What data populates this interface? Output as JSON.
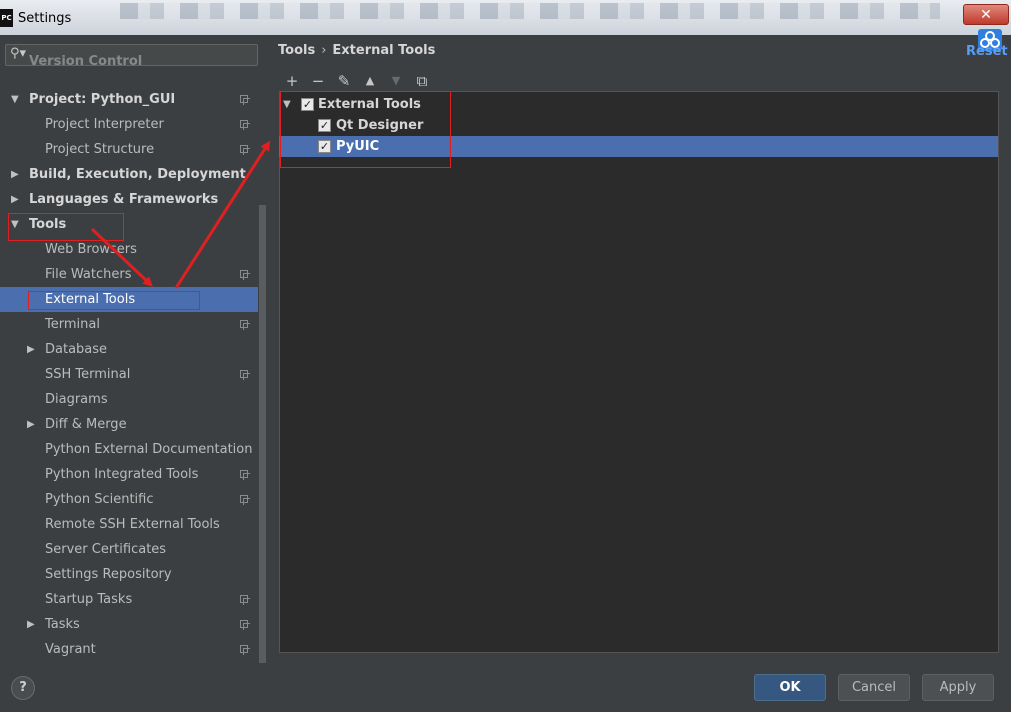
{
  "window": {
    "title": "Settings",
    "app_badge": "PC",
    "close": "✕"
  },
  "search": {
    "placeholder": "",
    "icon": "search-icon"
  },
  "tree": [
    {
      "label": "Version Control",
      "bold": true,
      "faded": true
    },
    {
      "label": "Project: Python_GUI",
      "bold": true,
      "expanded": true,
      "has_copy": true
    },
    {
      "label": "Project Interpreter",
      "has_copy": true
    },
    {
      "label": "Project Structure",
      "has_copy": true
    },
    {
      "label": "Build, Execution, Deployment",
      "bold": true,
      "collapsed": true
    },
    {
      "label": "Languages & Frameworks",
      "bold": true,
      "collapsed": true
    },
    {
      "label": "Tools",
      "bold": true,
      "expanded": true
    },
    {
      "label": "Web Browsers"
    },
    {
      "label": "File Watchers",
      "has_copy": true
    },
    {
      "label": "External Tools",
      "selected": true
    },
    {
      "label": "Terminal",
      "has_copy": true
    },
    {
      "label": "Database",
      "collapsed": true
    },
    {
      "label": "SSH Terminal",
      "has_copy": true
    },
    {
      "label": "Diagrams"
    },
    {
      "label": "Diff & Merge",
      "collapsed": true
    },
    {
      "label": "Python External Documentation"
    },
    {
      "label": "Python Integrated Tools",
      "has_copy": true
    },
    {
      "label": "Python Scientific",
      "has_copy": true
    },
    {
      "label": "Remote SSH External Tools"
    },
    {
      "label": "Server Certificates"
    },
    {
      "label": "Settings Repository"
    },
    {
      "label": "Startup Tasks",
      "has_copy": true
    },
    {
      "label": "Tasks",
      "collapsed": true,
      "has_copy": true
    },
    {
      "label": "Vagrant",
      "has_copy": true
    }
  ],
  "breadcrumb": {
    "root": "Tools",
    "separator": "›",
    "current": "External Tools"
  },
  "reset_label": "Reset",
  "toolbar": {
    "add": "+",
    "remove": "−",
    "edit": "✎",
    "up": "▲",
    "down": "▼",
    "copy": "⧉"
  },
  "tools_tree": [
    {
      "label": "External Tools",
      "checked": true,
      "expanded": true
    },
    {
      "label": "Qt Designer",
      "checked": true
    },
    {
      "label": "PyUIC",
      "checked": true,
      "selected": true
    }
  ],
  "buttons": {
    "ok": "OK",
    "cancel": "Cancel",
    "apply": "Apply",
    "help": "?"
  },
  "colors": {
    "selection": "#4b6eaf",
    "annotation": "#e02020",
    "reset": "#589df6"
  }
}
